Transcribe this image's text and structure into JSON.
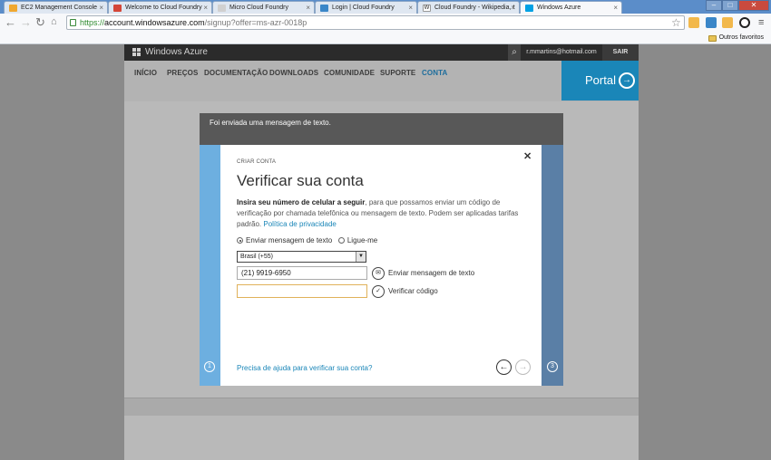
{
  "browser": {
    "tabs": [
      {
        "title": "EC2 Management Console",
        "color": "#f0a830"
      },
      {
        "title": "Welcome to Cloud Foundry",
        "color": "#d44638"
      },
      {
        "title": "Micro Cloud Foundry",
        "color": "#d0d0d0"
      },
      {
        "title": "Login | Cloud Foundry",
        "color": "#3a86c8"
      },
      {
        "title": "Cloud Foundry - Wikipedia, t",
        "color": "#ffffff"
      },
      {
        "title": "Windows Azure",
        "color": "#00a1e4"
      }
    ],
    "url": {
      "scheme": "https://",
      "host": "account.windowsazure.com",
      "path": "/signup?offer=ms-azr-0018p"
    },
    "bookmark_folder": "Outros favoritos"
  },
  "site": {
    "logo": "Windows Azure",
    "account": "r.mmartins@hotmail.com",
    "signout": "SAIR",
    "nav": [
      "INÍCIO",
      "PREÇOS",
      "DOCUMENTAÇÃO",
      "DOWNLOADS",
      "COMUNIDADE",
      "SUPORTE",
      "CONTA"
    ],
    "portal": "Portal"
  },
  "dialog": {
    "banner": "Foi enviada uma mensagem de texto.",
    "kicker": "CRIAR CONTA",
    "title": "Verificar sua conta",
    "intro_bold": "Insira seu número de celular a seguir",
    "intro_rest": ", para que possamos enviar um código de verificação por chamada telefônica ou mensagem de texto. Podem ser aplicadas tarifas padrão. ",
    "privacy_link": "Política de privacidade",
    "radio_text": "Enviar mensagem de texto",
    "radio_call": "Ligue-me",
    "country": "Brasil (+55)",
    "phone": "(21) 9919-6950",
    "code": "",
    "send_label": "Enviar mensagem de texto",
    "verify_label": "Verificar código",
    "help_link": "Precisa de ajuda para verificar sua conta?",
    "step_left": "1",
    "step_right": "3"
  }
}
